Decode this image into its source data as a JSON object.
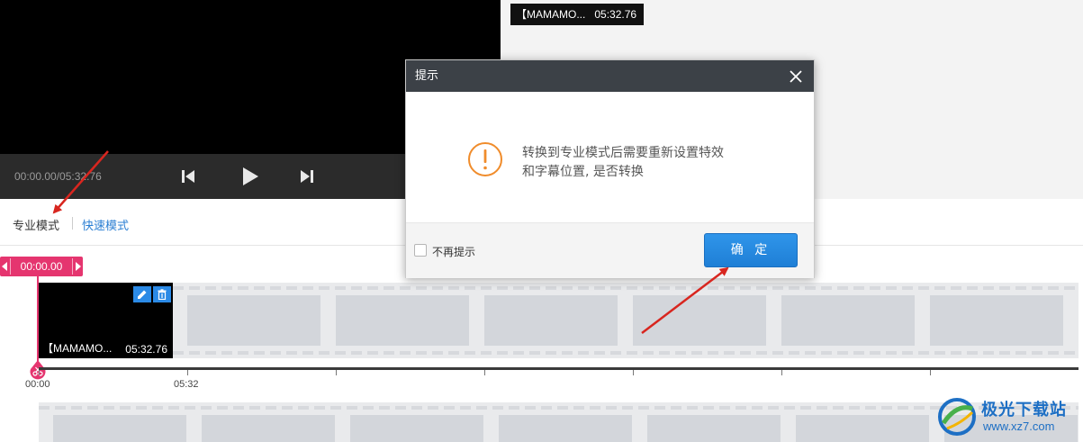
{
  "player": {
    "time_readout": "00:00.00/05:32.76",
    "preview_clip_name": "【MAMAMO...",
    "preview_clip_duration": "05:32.76"
  },
  "modes": {
    "pro": "专业模式",
    "fast": "快速模式"
  },
  "timeline": {
    "playhead_time": "00:00.00",
    "clip_name": "【MAMAMO...",
    "clip_duration": "05:32.76",
    "ruler_labels": [
      "00:00",
      "05:32"
    ]
  },
  "dialog": {
    "title": "提示",
    "message_line1": "转换到专业模式后需要重新设置特效",
    "message_line2": "和字幕位置, 是否转换",
    "dont_show_again": "不再提示",
    "confirm": "确 定"
  },
  "watermark": {
    "title": "极光下载站",
    "url": "www.xz7.com"
  },
  "colors": {
    "accent_pink": "#e5356f",
    "button_blue": "#1f7fd6",
    "warning_orange": "#f08c2b",
    "arrow_red": "#d8261f"
  },
  "icons": [
    "skip-back-icon",
    "play-icon",
    "skip-forward-icon",
    "edit-icon",
    "trash-icon",
    "close-icon",
    "warning-icon",
    "scissors-icon"
  ]
}
